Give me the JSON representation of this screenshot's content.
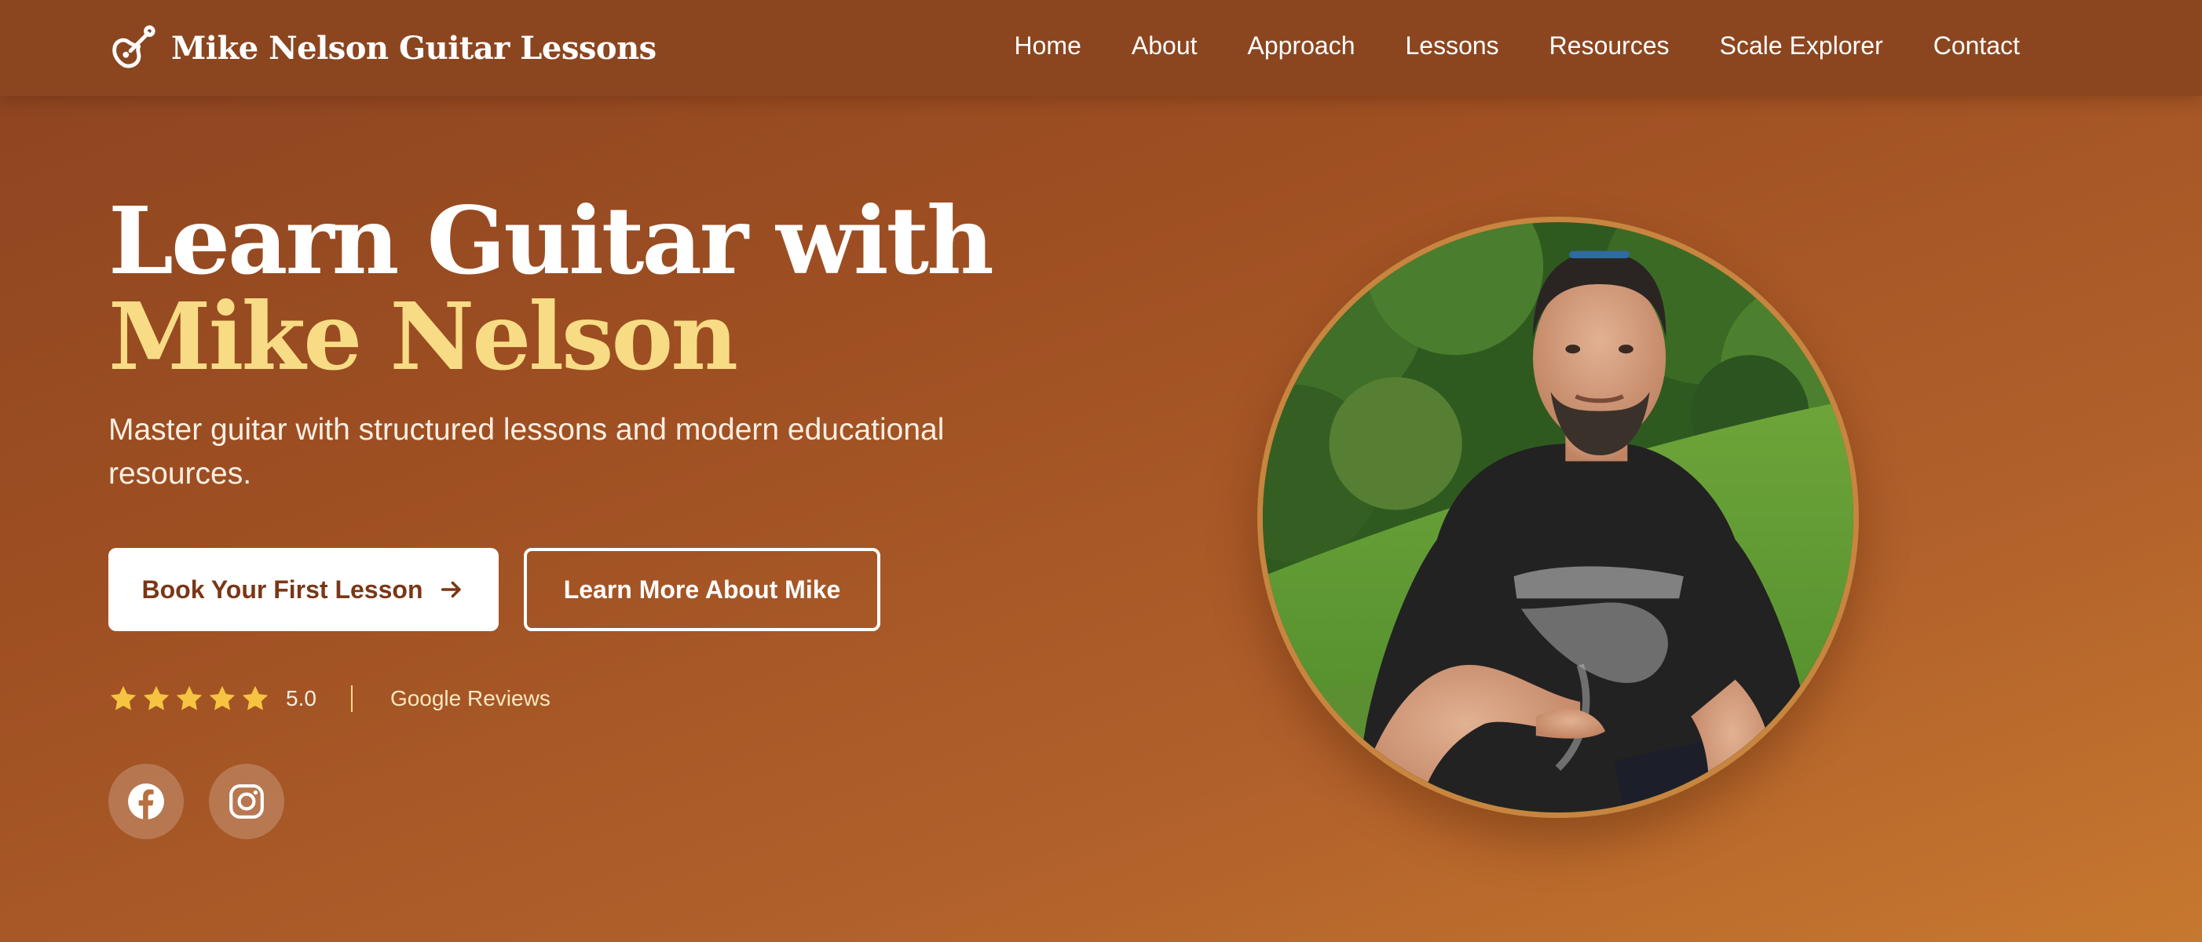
{
  "header": {
    "brand_name": "Mike Nelson Guitar Lessons",
    "brand_icon": "guitar-icon",
    "nav": [
      "Home",
      "About",
      "Approach",
      "Lessons",
      "Resources",
      "Scale Explorer",
      "Contact"
    ]
  },
  "hero": {
    "title_line1": "Learn Guitar with",
    "title_line2": "Mike Nelson",
    "subtitle": "Master guitar with structured lessons and modern educational resources.",
    "primary_button": "Book Your First Lesson",
    "primary_button_icon": "arrow-right-icon",
    "secondary_button": "Learn More About Mike",
    "rating_stars": 5,
    "rating_value": "5.0",
    "reviews_label": "Google Reviews",
    "social": [
      "facebook-icon",
      "instagram-icon"
    ],
    "portrait_alt": "Portrait photo of Mike Nelson"
  },
  "colors": {
    "header_bg": "#8b4620",
    "gradient_start": "#8c4420",
    "gradient_end": "#c7782f",
    "title_accent": "#f8dc85",
    "star": "#f6c343",
    "button_text": "#7a3716"
  }
}
